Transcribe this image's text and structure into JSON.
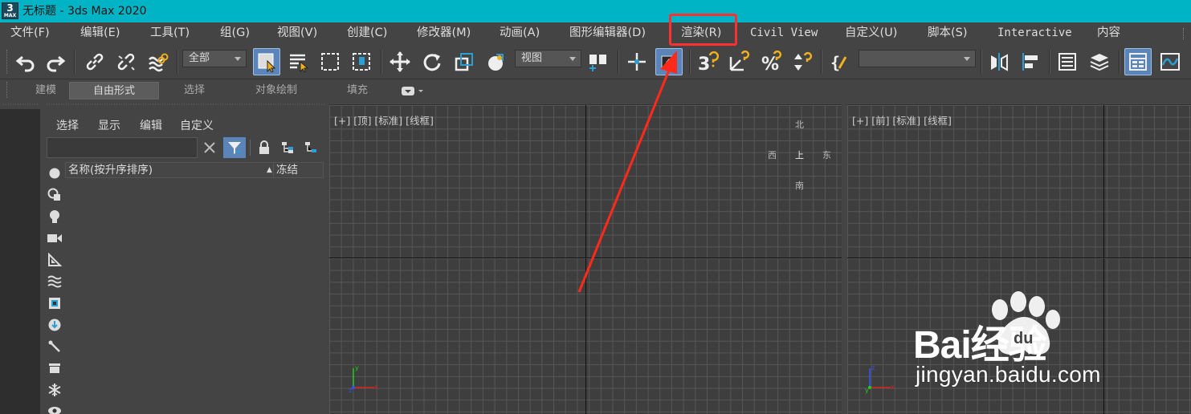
{
  "titlebar": {
    "logo_digit": "3",
    "logo_sub": "MAX",
    "title": "无标题 - 3ds Max 2020"
  },
  "menubar": {
    "file": "文件(F)",
    "edit": "编辑(E)",
    "tools": "工具(T)",
    "group": "组(G)",
    "views": "视图(V)",
    "create": "创建(C)",
    "modifiers": "修改器(M)",
    "animation": "动画(A)",
    "graph_editors": "图形编辑器(D)",
    "rendering": "渲染(R)",
    "civil_view": "Civil View",
    "customize": "自定义(U)",
    "scripting": "脚本(S)",
    "interactive": "Interactive",
    "content": "内容"
  },
  "toolbar": {
    "selection_filter": "全部",
    "reference_coord": "视图",
    "named_selection": ""
  },
  "ribbon": {
    "tabs": [
      "建模",
      "自由形式",
      "选择",
      "对象绘制",
      "填充"
    ]
  },
  "scene_explorer": {
    "tabs": [
      "选择",
      "显示",
      "编辑",
      "自定义"
    ],
    "search_value": "",
    "col_name": "名称(按升序排序)",
    "col_sort_indicator": "▲",
    "col_frozen": "冻结"
  },
  "viewports": {
    "top": {
      "label": "[+] [顶] [标准] [线框]"
    },
    "front": {
      "label": "[+] [前] [标准] [线框]"
    },
    "viewcube": {
      "north": "北",
      "south": "南",
      "west": "西",
      "east": "东",
      "face": "上"
    },
    "axes": {
      "x": "x",
      "y": "y",
      "z": "z"
    }
  },
  "watermark": {
    "brand": "Bai经验",
    "brand_du": "du",
    "url": "jingyan.baidu.com"
  },
  "colors": {
    "titlebar": "#00b4c6",
    "highlight_box": "#ff3030",
    "arrow": "#ff2a1a",
    "active_button": "#5b85b8"
  },
  "icons": [
    "undo-icon",
    "redo-icon",
    "link-icon",
    "unlink-icon",
    "bind-spacewarp-icon",
    "select-object-icon",
    "select-by-name-icon",
    "rect-region-icon",
    "window-crossing-icon",
    "move-icon",
    "rotate-icon",
    "scale-icon",
    "selection-center-icon",
    "place-icon",
    "pivot-icon",
    "keyboard-shortcut-icon",
    "snap-3d-icon",
    "angle-snap-icon",
    "percent-snap-icon",
    "spinner-snap-icon",
    "edit-named-selection-icon",
    "mirror-icon",
    "align-icon",
    "scene-explorer-icon",
    "layer-explorer-icon",
    "ribbon-toggle-icon",
    "curve-editor-icon"
  ]
}
